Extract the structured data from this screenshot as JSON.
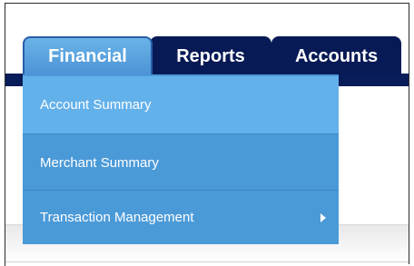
{
  "nav": {
    "tabs": [
      {
        "label": "Financial",
        "active": true
      },
      {
        "label": "Reports",
        "active": false
      },
      {
        "label": "Accounts",
        "active": false
      }
    ]
  },
  "dropdown": {
    "items": [
      {
        "label": "Account Summary",
        "highlighted": true,
        "has_submenu": false
      },
      {
        "label": "Merchant Summary",
        "highlighted": false,
        "has_submenu": false
      },
      {
        "label": "Transaction Management",
        "highlighted": false,
        "has_submenu": true,
        "submenu_icon": "chevron-right-icon"
      }
    ]
  },
  "colors": {
    "nav_bar": "#081c5a",
    "active_tab": "#5aa6e2",
    "menu_background": "#4b9ad8",
    "menu_highlight": "#63b1eb",
    "text": "#ffffff"
  }
}
